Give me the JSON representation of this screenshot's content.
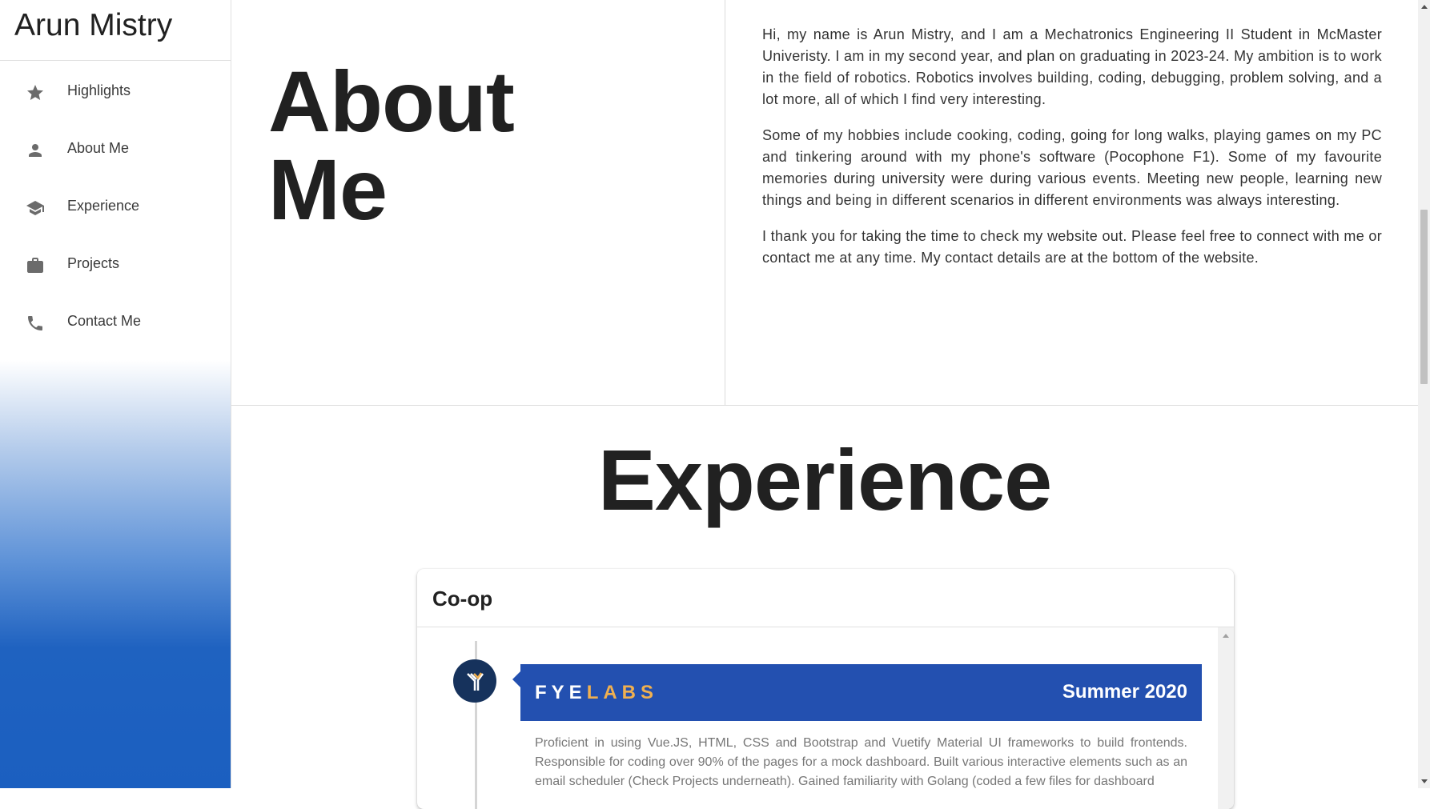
{
  "sidebar": {
    "title": "Arun Mistry",
    "items": [
      {
        "label": "Highlights",
        "icon": "star-icon"
      },
      {
        "label": "About Me",
        "icon": "person-icon"
      },
      {
        "label": "Experience",
        "icon": "graduation-cap-icon"
      },
      {
        "label": "Projects",
        "icon": "briefcase-icon"
      },
      {
        "label": "Contact Me",
        "icon": "phone-icon"
      }
    ]
  },
  "about": {
    "heading_line1": "About",
    "heading_line2": "Me",
    "paragraphs": [
      "Hi, my name is Arun Mistry, and I am a Mechatronics Engineering II Student in McMaster Univeristy. I am in my second year, and plan on graduating in 2023-24. My ambition is to work in the field of robotics. Robotics involves building, coding, debugging, problem solving, and a lot more, all of which I find very interesting.",
      "Some of my hobbies include cooking, coding, going for long walks, playing games on my PC and tinkering around with my phone's software (Pocophone F1). Some of my favourite memories during university were during various events. Meeting new people, learning new things and being in different scenarios in different environments was always interesting.",
      "I thank you for taking the time to check my website out. Please feel free to connect with me or contact me at any time. My contact details are at the bottom of the website."
    ]
  },
  "experience": {
    "heading": "Experience",
    "card": {
      "title": "Co-op",
      "entries": [
        {
          "company_part1": "FYE",
          "company_part2": "LABS",
          "date": "Summer 2020",
          "description": "Proficient in using Vue.JS, HTML, CSS and Bootstrap and Vuetify Material UI frameworks to build frontends. Responsible for coding over 90% of the pages for a mock dashboard. Built various interactive elements such as an email scheduler (Check Projects underneath). Gained familiarity with Golang (coded a few files for dashboard"
        }
      ]
    }
  },
  "colors": {
    "sidebar_gradient_bottom": "#1b5fc0",
    "entry_header": "#2350b0",
    "brand_accent": "#f0b050",
    "logo_bg": "#16325c"
  }
}
